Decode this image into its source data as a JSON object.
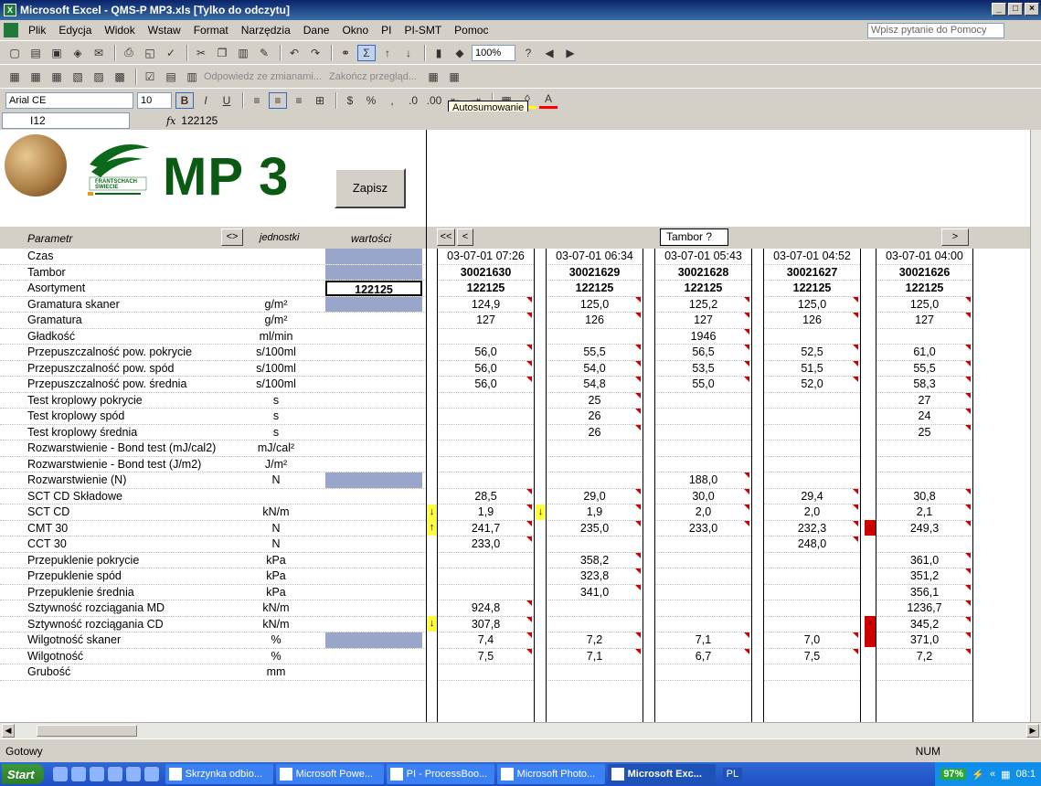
{
  "window": {
    "title": "Microsoft Excel - QMS-P MP3.xls  [Tylko do odczytu]",
    "controls": [
      "_",
      "□",
      "×"
    ]
  },
  "menu": {
    "items": [
      "Plik",
      "Edycja",
      "Widok",
      "Wstaw",
      "Format",
      "Narzędzia",
      "Dane",
      "Okno",
      "PI",
      "PI-SMT",
      "Pomoc"
    ],
    "help_placeholder": "Wpisz pytanie do Pomocy"
  },
  "toolbar": {
    "zoom": "100%",
    "review_reply": "Odpowiedz ze zmianami...",
    "review_end": "Zakończ przegląd...",
    "font_name": "Arial CE",
    "font_size": "10",
    "tooltip": "Autosumowanie"
  },
  "formula_bar": {
    "cell_ref": "I12",
    "fx": "fx",
    "content": "122125"
  },
  "sheet": {
    "title": "MP 3",
    "logo_text": "FRANTSCHACH ŚWIECIE",
    "save_button": "Zapisz",
    "headers": {
      "param": "Parametr",
      "swap": "<>",
      "units": "jednostki",
      "values": "wartości",
      "nav_first": "<<",
      "nav_prev": "<",
      "tambor": "Tambor ?",
      "nav_next": ">"
    },
    "rows": [
      {
        "param": "Czas",
        "unit": "",
        "val": "",
        "style": "blue"
      },
      {
        "param": "Tambor",
        "unit": "",
        "val": "",
        "style": "blue"
      },
      {
        "param": "Asortyment",
        "unit": "",
        "val": "122125",
        "style": "box"
      },
      {
        "param": "Gramatura skaner",
        "unit": "g/m²",
        "val": "",
        "style": "blue"
      },
      {
        "param": "Gramatura",
        "unit": "g/m²",
        "val": "",
        "style": ""
      },
      {
        "param": "Gładkość",
        "unit": "ml/min",
        "val": "",
        "style": ""
      },
      {
        "param": "Przepuszczalność pow. pokrycie",
        "unit": "s/100ml",
        "val": "",
        "style": ""
      },
      {
        "param": "Przepuszczalność pow. spód",
        "unit": "s/100ml",
        "val": "",
        "style": ""
      },
      {
        "param": "Przepuszczalność pow. średnia",
        "unit": "s/100ml",
        "val": "",
        "style": ""
      },
      {
        "param": "Test kroplowy pokrycie",
        "unit": "s",
        "val": "",
        "style": ""
      },
      {
        "param": "Test kroplowy spód",
        "unit": "s",
        "val": "",
        "style": ""
      },
      {
        "param": "Test kroplowy średnia",
        "unit": "s",
        "val": "",
        "style": ""
      },
      {
        "param": "Rozwarstwienie - Bond test (mJ/cal2)",
        "unit": "mJ/cal²",
        "val": "",
        "style": ""
      },
      {
        "param": "Rozwarstwienie - Bond test (J/m2)",
        "unit": "J/m²",
        "val": "",
        "style": ""
      },
      {
        "param": "Rozwarstwienie  (N)",
        "unit": "N",
        "val": "",
        "style": "blue"
      },
      {
        "param": "SCT CD Składowe",
        "unit": "",
        "val": "",
        "style": ""
      },
      {
        "param": "SCT CD",
        "unit": "kN/m",
        "val": "",
        "style": ""
      },
      {
        "param": "CMT 30",
        "unit": "N",
        "val": "",
        "style": ""
      },
      {
        "param": "CCT 30",
        "unit": "N",
        "val": "",
        "style": ""
      },
      {
        "param": "Przepuklenie pokrycie",
        "unit": "kPa",
        "val": "",
        "style": ""
      },
      {
        "param": "Przepuklenie spód",
        "unit": "kPa",
        "val": "",
        "style": ""
      },
      {
        "param": "Przepuklenie średnia",
        "unit": "kPa",
        "val": "",
        "style": ""
      },
      {
        "param": "Sztywność rozciągania MD",
        "unit": "kN/m",
        "val": "",
        "style": ""
      },
      {
        "param": "Sztywność rozciągania CD",
        "unit": "kN/m",
        "val": "",
        "style": ""
      },
      {
        "param": "Wilgotność skaner",
        "unit": "%",
        "val": "",
        "style": "blue"
      },
      {
        "param": "Wilgotność",
        "unit": "%",
        "val": "",
        "style": ""
      },
      {
        "param": "Grubość",
        "unit": "mm",
        "val": "",
        "style": ""
      }
    ],
    "samples": [
      {
        "time": "03-07-01 07:26",
        "tambor": "30021630",
        "asort": "122125",
        "values": [
          "124,9",
          "127",
          "",
          "56,0",
          "56,0",
          "56,0",
          "",
          "",
          "",
          "",
          "",
          "",
          "28,5",
          "1,9",
          "241,7",
          "233,0",
          "",
          "",
          "",
          "924,8",
          "307,8",
          "7,4",
          "7,5",
          ""
        ]
      },
      {
        "time": "03-07-01 06:34",
        "tambor": "30021629",
        "asort": "122125",
        "values": [
          "125,0",
          "126",
          "",
          "55,5",
          "54,0",
          "54,8",
          "25",
          "26",
          "26",
          "",
          "",
          "",
          "29,0",
          "1,9",
          "235,0",
          "",
          "358,2",
          "323,8",
          "341,0",
          "",
          "",
          "7,2",
          "7,1",
          ""
        ]
      },
      {
        "time": "03-07-01 05:43",
        "tambor": "30021628",
        "asort": "122125",
        "values": [
          "125,2",
          "127",
          "1946",
          "56,5",
          "53,5",
          "55,0",
          "",
          "",
          "",
          "",
          "",
          "188,0",
          "30,0",
          "2,0",
          "233,0",
          "",
          "",
          "",
          "",
          "",
          "",
          "7,1",
          "6,7",
          ""
        ]
      },
      {
        "time": "03-07-01 04:52",
        "tambor": "30021627",
        "asort": "122125",
        "values": [
          "125,0",
          "126",
          "",
          "52,5",
          "51,5",
          "52,0",
          "",
          "",
          "",
          "",
          "",
          "",
          "29,4",
          "2,0",
          "232,3",
          "248,0",
          "",
          "",
          "",
          "",
          "",
          "7,0",
          "7,5",
          ""
        ]
      },
      {
        "time": "03-07-01 04:00",
        "tambor": "30021626",
        "asort": "122125",
        "values": [
          "125,0",
          "127",
          "",
          "61,0",
          "55,5",
          "58,3",
          "27",
          "24",
          "25",
          "",
          "",
          "",
          "30,8",
          "2,1",
          "249,3",
          "",
          "361,0",
          "351,2",
          "356,1",
          "1236,7",
          "345,2",
          "371,0",
          "7,2",
          ""
        ]
      }
    ]
  },
  "status": {
    "ready": "Gotowy",
    "num": "NUM"
  },
  "taskbar": {
    "start": "Start",
    "tasks": [
      "Skrzynka odbio...",
      "Microsoft Powe...",
      "PI - ProcessBoo...",
      "Microsoft Photo...",
      "Microsoft Exc..."
    ],
    "lang": "PL",
    "battery": "97%",
    "clock": "08:1"
  },
  "colors": {
    "title_gradient_start": "#0a246a",
    "mp3_green": "#0b5a14",
    "input_blue": "#9aa6c9",
    "alert_red": "#d00000",
    "arrow_yellow": "#ffff40"
  }
}
